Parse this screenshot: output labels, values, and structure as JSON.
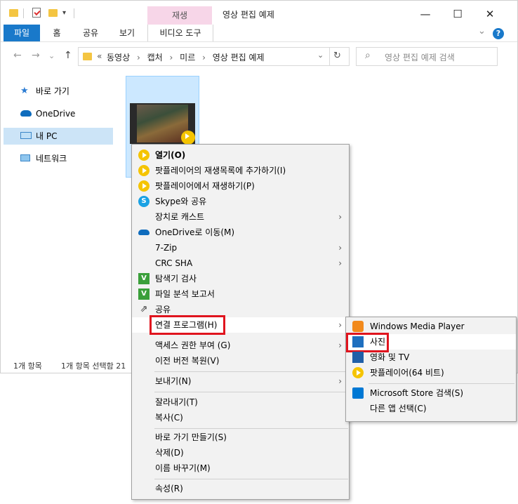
{
  "window": {
    "context_tab_group": "재생",
    "title": "영상 편집 예제",
    "controls": {
      "minimize": "—",
      "maximize": "☐",
      "close": "✕"
    }
  },
  "ribbon": {
    "tabs": [
      "파일",
      "홈",
      "공유",
      "보기",
      "비디오 도구"
    ],
    "collapse_glyph": "⌄",
    "help_glyph": "?"
  },
  "address": {
    "back": "←",
    "forward": "→",
    "recent": "⌄",
    "up": "↑",
    "overflow": "«",
    "crumbs": [
      "동영상",
      "캡처",
      "미르",
      "영상 편집 예제"
    ],
    "separator": "›",
    "dropdown": "⌄",
    "refresh": "↻"
  },
  "search": {
    "placeholder": "영상 편집 예제 검색",
    "icon_glyph": "⌕"
  },
  "nav": {
    "items": [
      {
        "label": "바로 가기",
        "icon": "star-icon"
      },
      {
        "label": "OneDrive",
        "icon": "cloud-icon"
      },
      {
        "label": "내 PC",
        "icon": "pc-icon"
      },
      {
        "label": "네트워크",
        "icon": "network-icon"
      }
    ],
    "selected": "내 PC"
  },
  "status": {
    "count": "1개 항목",
    "selected": "1개 항목 선택함 21"
  },
  "context_menu": {
    "items": [
      {
        "label": "열기(O)",
        "icon": "potplayer-icon",
        "bold": true
      },
      {
        "label": "팟플레이어의 재생목록에 추가하기(I)",
        "icon": "potplayer-icon"
      },
      {
        "label": "팟플레이어에서 재생하기(P)",
        "icon": "potplayer-icon"
      },
      {
        "label": "Skype와 공유",
        "icon": "skype-icon"
      },
      {
        "label": "장치로 캐스트",
        "submenu": true
      },
      {
        "label": "OneDrive로 이동(M)",
        "icon": "cloud-icon"
      },
      {
        "label": "7-Zip",
        "submenu": true
      },
      {
        "label": "CRC SHA",
        "submenu": true
      },
      {
        "label": "탐색기 검사",
        "icon": "v3-icon"
      },
      {
        "label": "파일 분석 보고서",
        "icon": "v3-icon"
      },
      {
        "label": "공유",
        "icon": "share-icon"
      },
      {
        "label": "연결 프로그램(H)",
        "submenu": true,
        "highlighted": true
      },
      {
        "label": "액세스 권한 부여 (G)",
        "submenu": true
      },
      {
        "label": "이전 버전 복원(V)"
      },
      {
        "label": "보내기(N)",
        "submenu": true
      },
      {
        "label": "잘라내기(T)"
      },
      {
        "label": "복사(C)"
      },
      {
        "label": "바로 가기 만들기(S)"
      },
      {
        "label": "삭제(D)"
      },
      {
        "label": "이름 바꾸기(M)"
      },
      {
        "label": "속성(R)"
      }
    ],
    "arrow_glyph": "›"
  },
  "submenu": {
    "items": [
      {
        "label": "Windows Media Player",
        "icon": "wmp-icon"
      },
      {
        "label": "사진",
        "icon": "photos-icon",
        "highlighted": true
      },
      {
        "label": "영화 및 TV",
        "icon": "movies-tv-icon"
      },
      {
        "label": "팟플레이어(64 비트)",
        "icon": "potplayer-icon"
      },
      {
        "label": "Microsoft Store 검색(S)",
        "icon": "store-icon"
      },
      {
        "label": "다른 앱 선택(C)"
      }
    ]
  },
  "colors": {
    "accent": "#1979ca",
    "highlight_box": "#e0141e",
    "selection": "#cce8ff",
    "context_tab": "#f7d6e8"
  }
}
